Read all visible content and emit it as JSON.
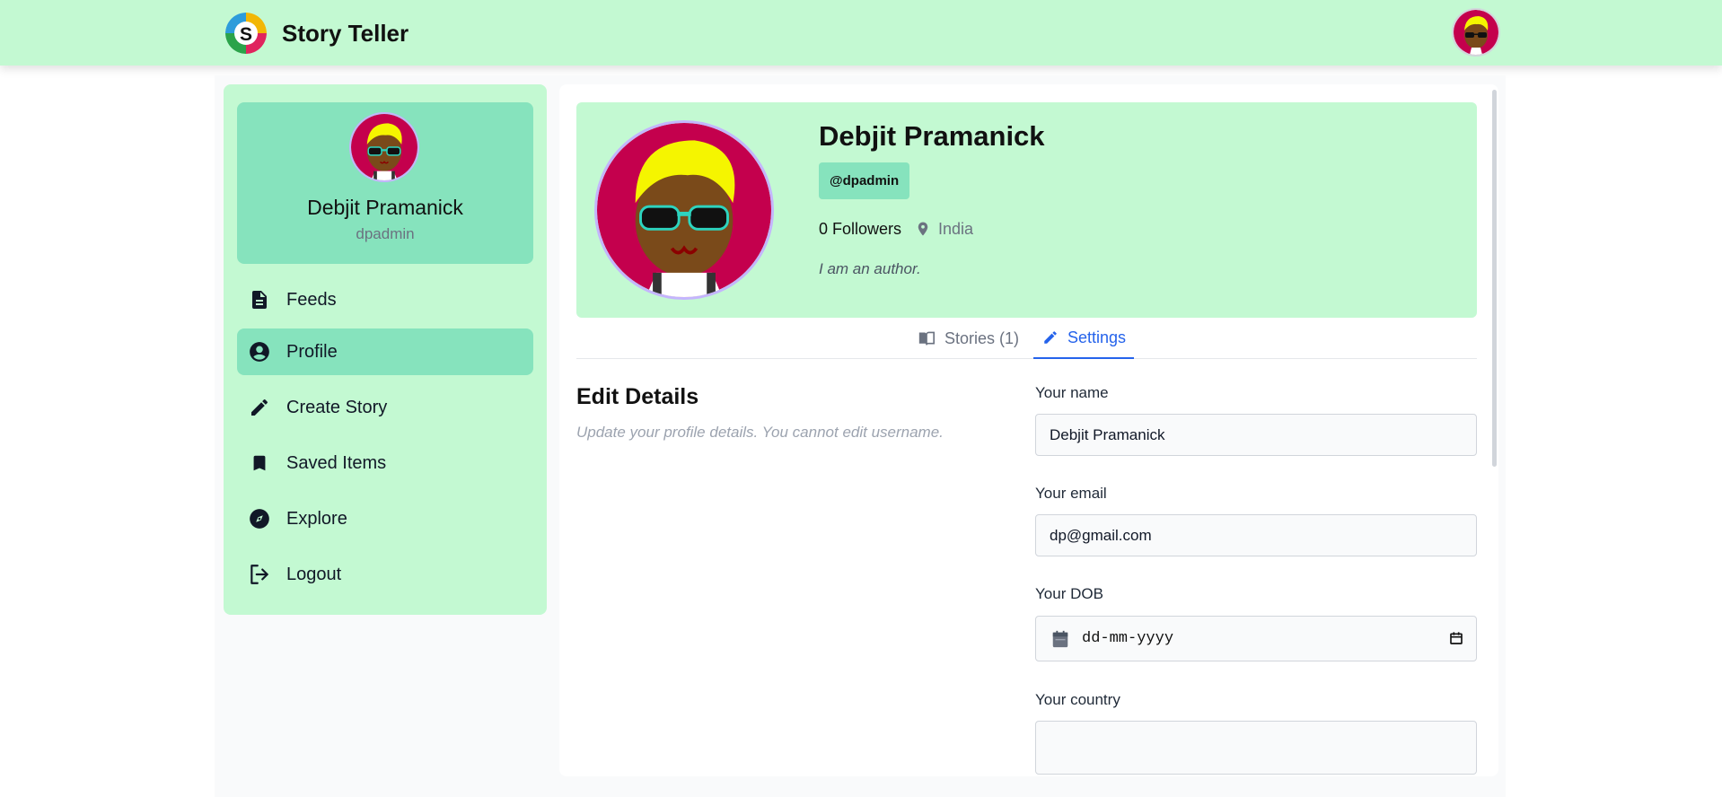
{
  "app": {
    "title": "Story Teller",
    "logo_letter": "S"
  },
  "sidebar": {
    "user": {
      "name": "Debjit Pramanick",
      "username": "dpadmin"
    },
    "items": [
      {
        "label": "Feeds",
        "icon": "document-icon",
        "active": false
      },
      {
        "label": "Profile",
        "icon": "account-circle-icon",
        "active": true
      },
      {
        "label": "Create Story",
        "icon": "pencil-icon",
        "active": false
      },
      {
        "label": "Saved Items",
        "icon": "bookmark-icon",
        "active": false
      },
      {
        "label": "Explore",
        "icon": "compass-icon",
        "active": false
      },
      {
        "label": "Logout",
        "icon": "logout-icon",
        "active": false
      }
    ]
  },
  "profile": {
    "name": "Debjit Pramanick",
    "handle": "@dpadmin",
    "followers": "0 Followers",
    "location": "India",
    "bio": "I am an author."
  },
  "tabs": [
    {
      "label": "Stories (1)",
      "icon": "book-open-icon",
      "active": false
    },
    {
      "label": "Settings",
      "icon": "pencil-icon",
      "active": true
    }
  ],
  "edit": {
    "title": "Edit Details",
    "description": "Update your profile details. You cannot edit username.",
    "name_label": "Your name",
    "name_value": "Debjit Pramanick",
    "email_label": "Your email",
    "email_value": "dp@gmail.com",
    "dob_label": "Your DOB",
    "dob_placeholder": "dd-mm-yyyy",
    "country_label": "Your country"
  },
  "colors": {
    "header_bg": "#c3f9d2",
    "accent_green": "#86e3bd",
    "active_tab": "#2563eb"
  }
}
